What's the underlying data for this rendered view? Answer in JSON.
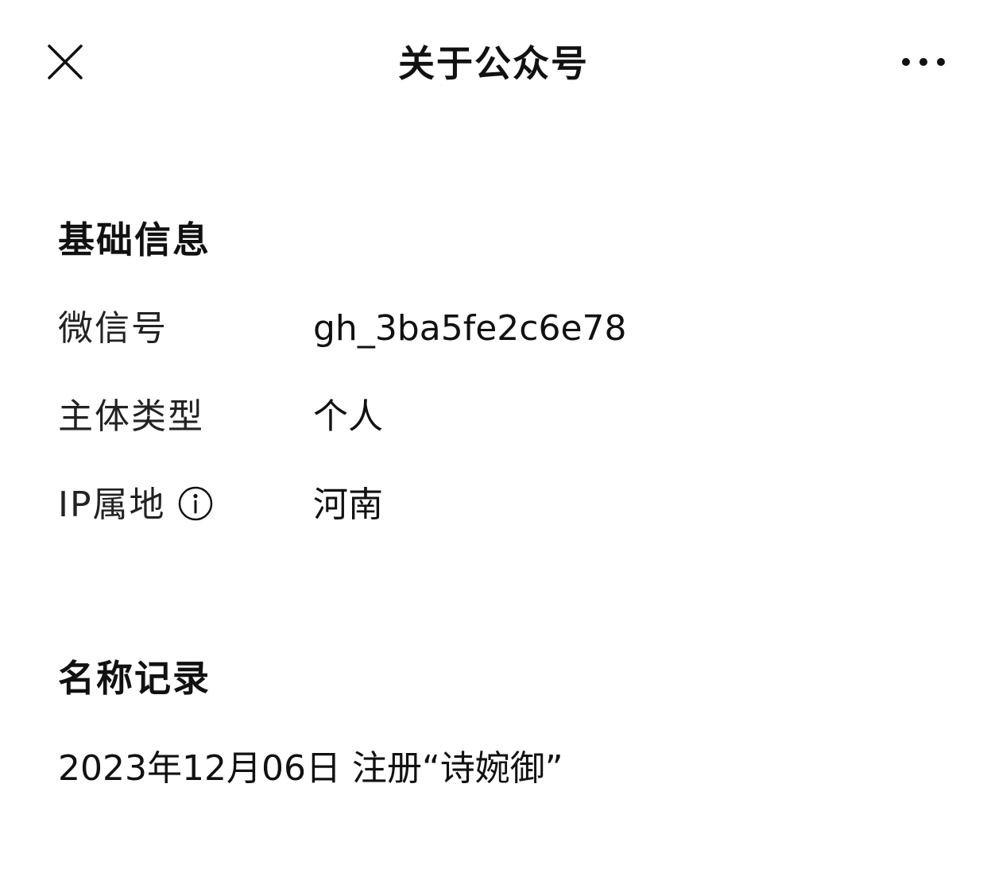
{
  "header": {
    "title": "关于公众号",
    "close_icon": "close-icon",
    "more_icon": "more-horizontal-icon"
  },
  "basic_info": {
    "section_title": "基础信息",
    "rows": [
      {
        "label": "微信号",
        "value": "gh_3ba5fe2c6e78"
      },
      {
        "label": "主体类型",
        "value": "个人"
      },
      {
        "label": "IP属地",
        "value": "河南",
        "icon": "info-icon"
      }
    ]
  },
  "name_history": {
    "section_title": "名称记录",
    "items": [
      {
        "text": "2023年12月06日 注册“诗婉御”"
      }
    ]
  }
}
